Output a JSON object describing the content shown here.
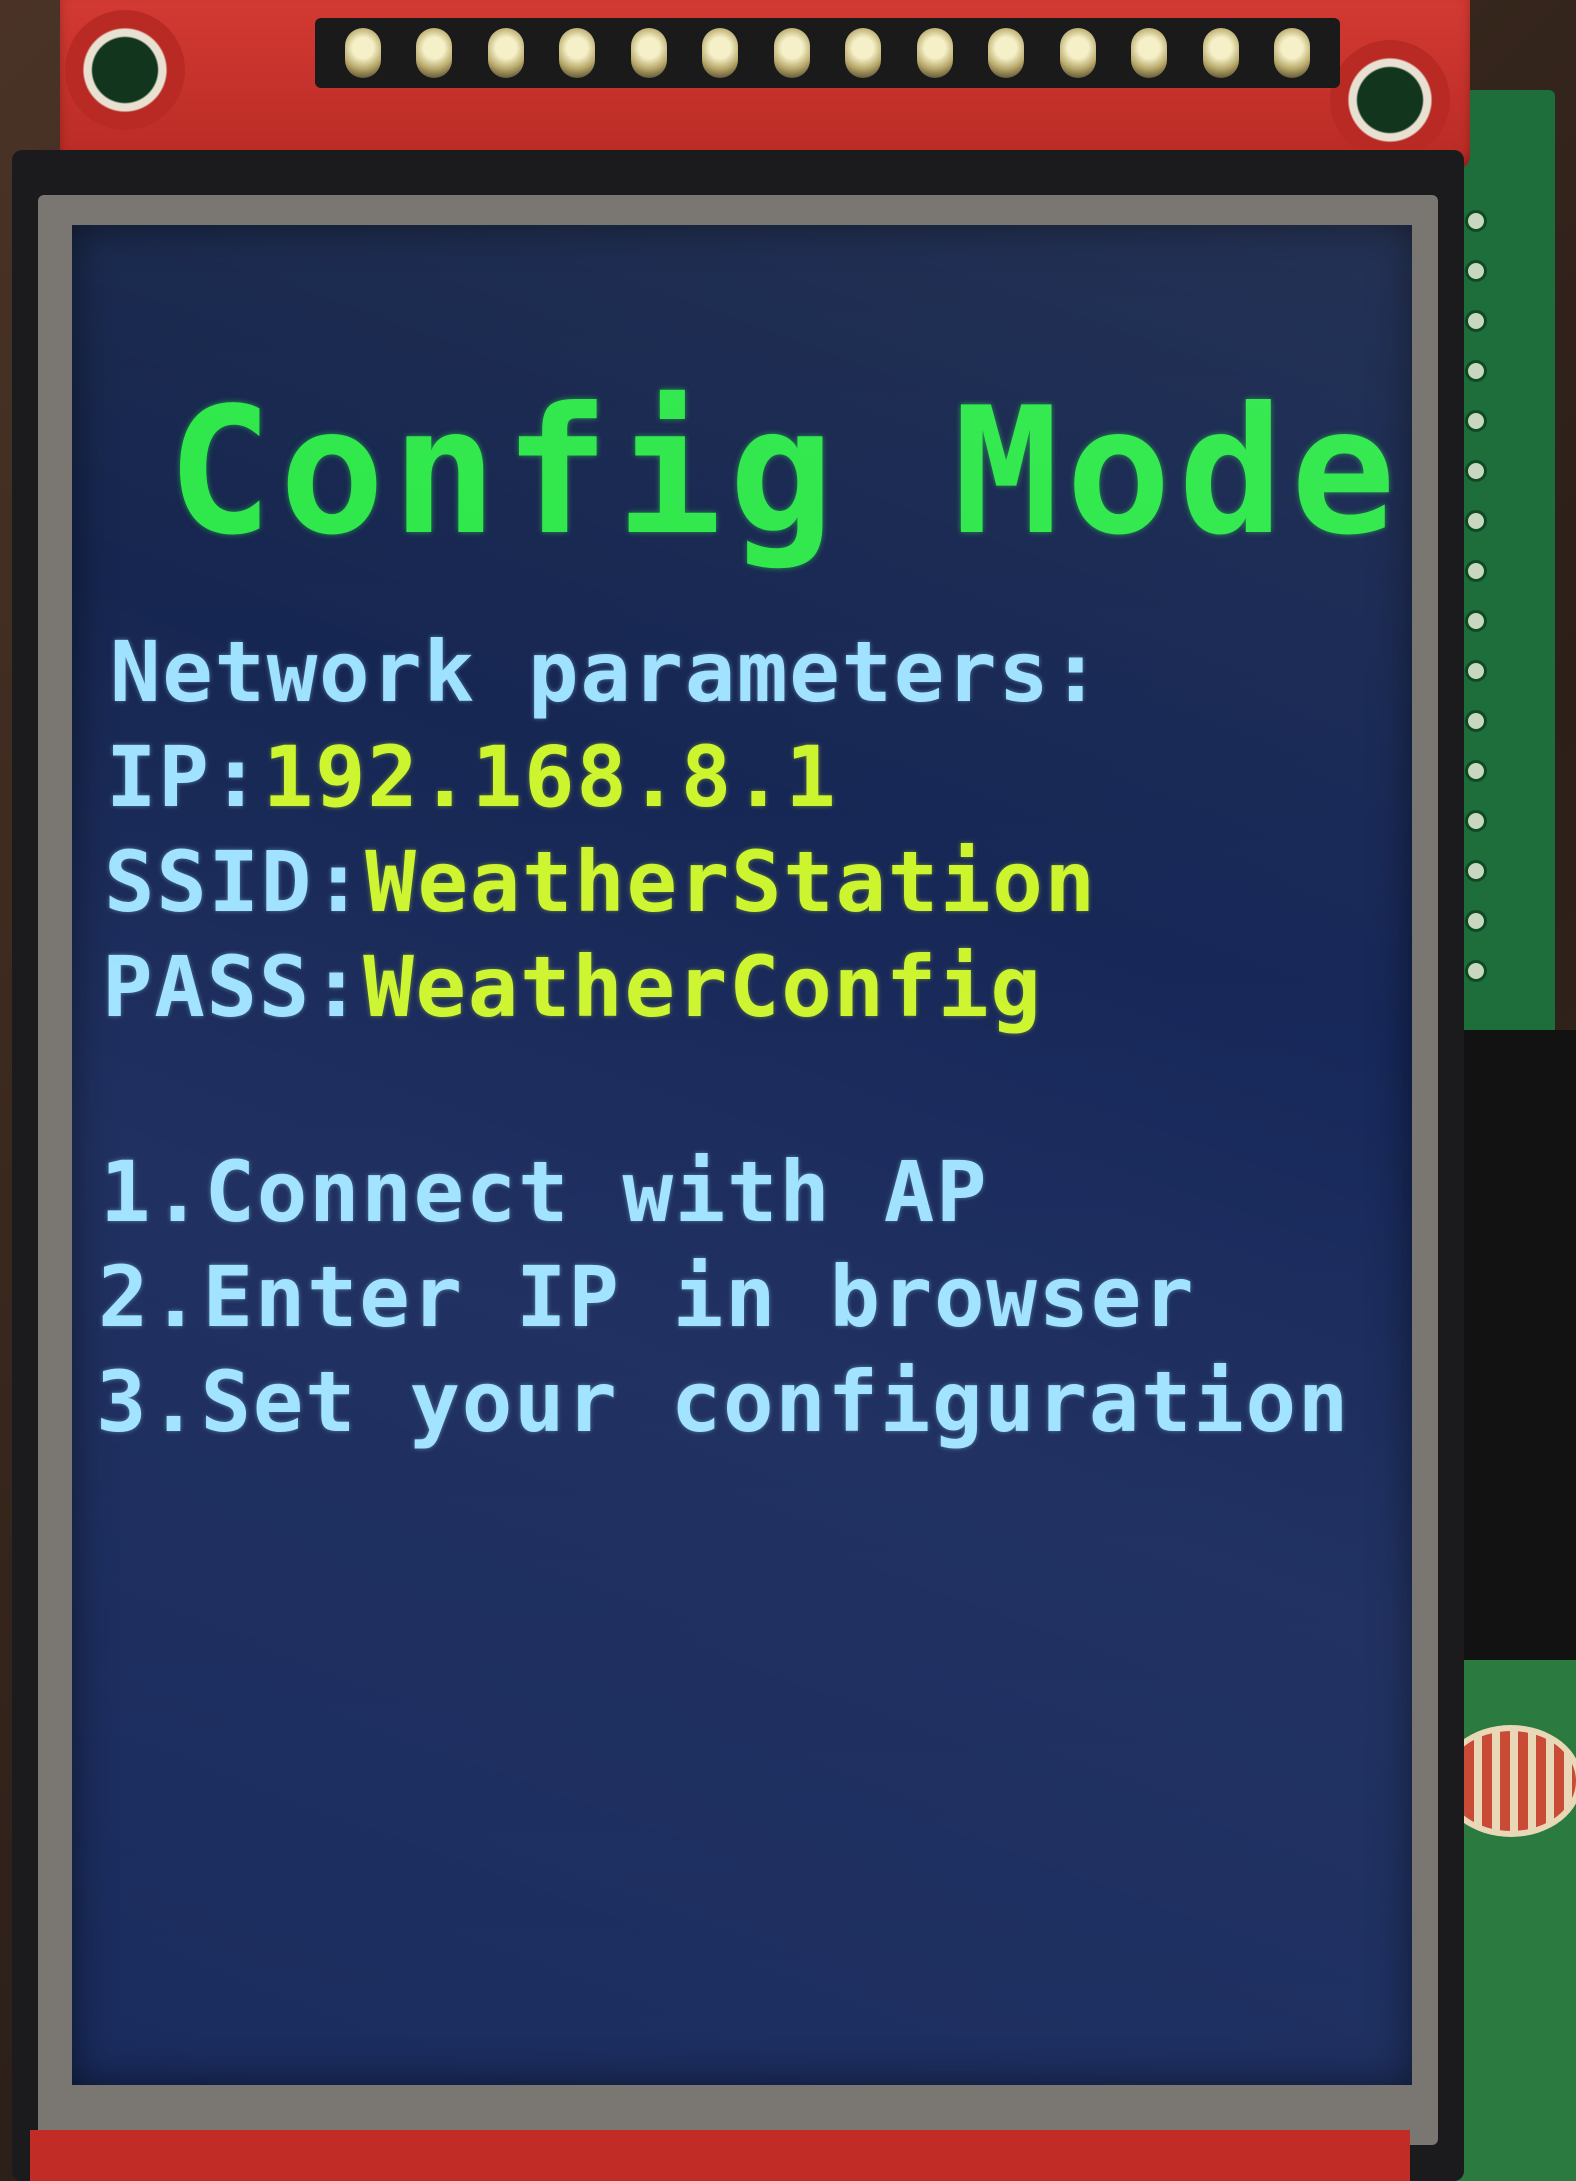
{
  "screen": {
    "title": "Config Mode",
    "heading": "Network parameters:",
    "ip_label": "IP:",
    "ip_value": "192.168.8.1",
    "ssid_label": "SSID:",
    "ssid_value": "WeatherStation",
    "pass_label": "PASS:",
    "pass_value": "WeatherConfig",
    "steps": [
      "1.Connect with AP",
      "2.Enter IP in browser",
      "3.Set your configuration"
    ]
  },
  "colors": {
    "title": "#2ee84a",
    "text": "#9fe2ff",
    "value": "#cdf52e",
    "screen_bg": "#17285a"
  }
}
